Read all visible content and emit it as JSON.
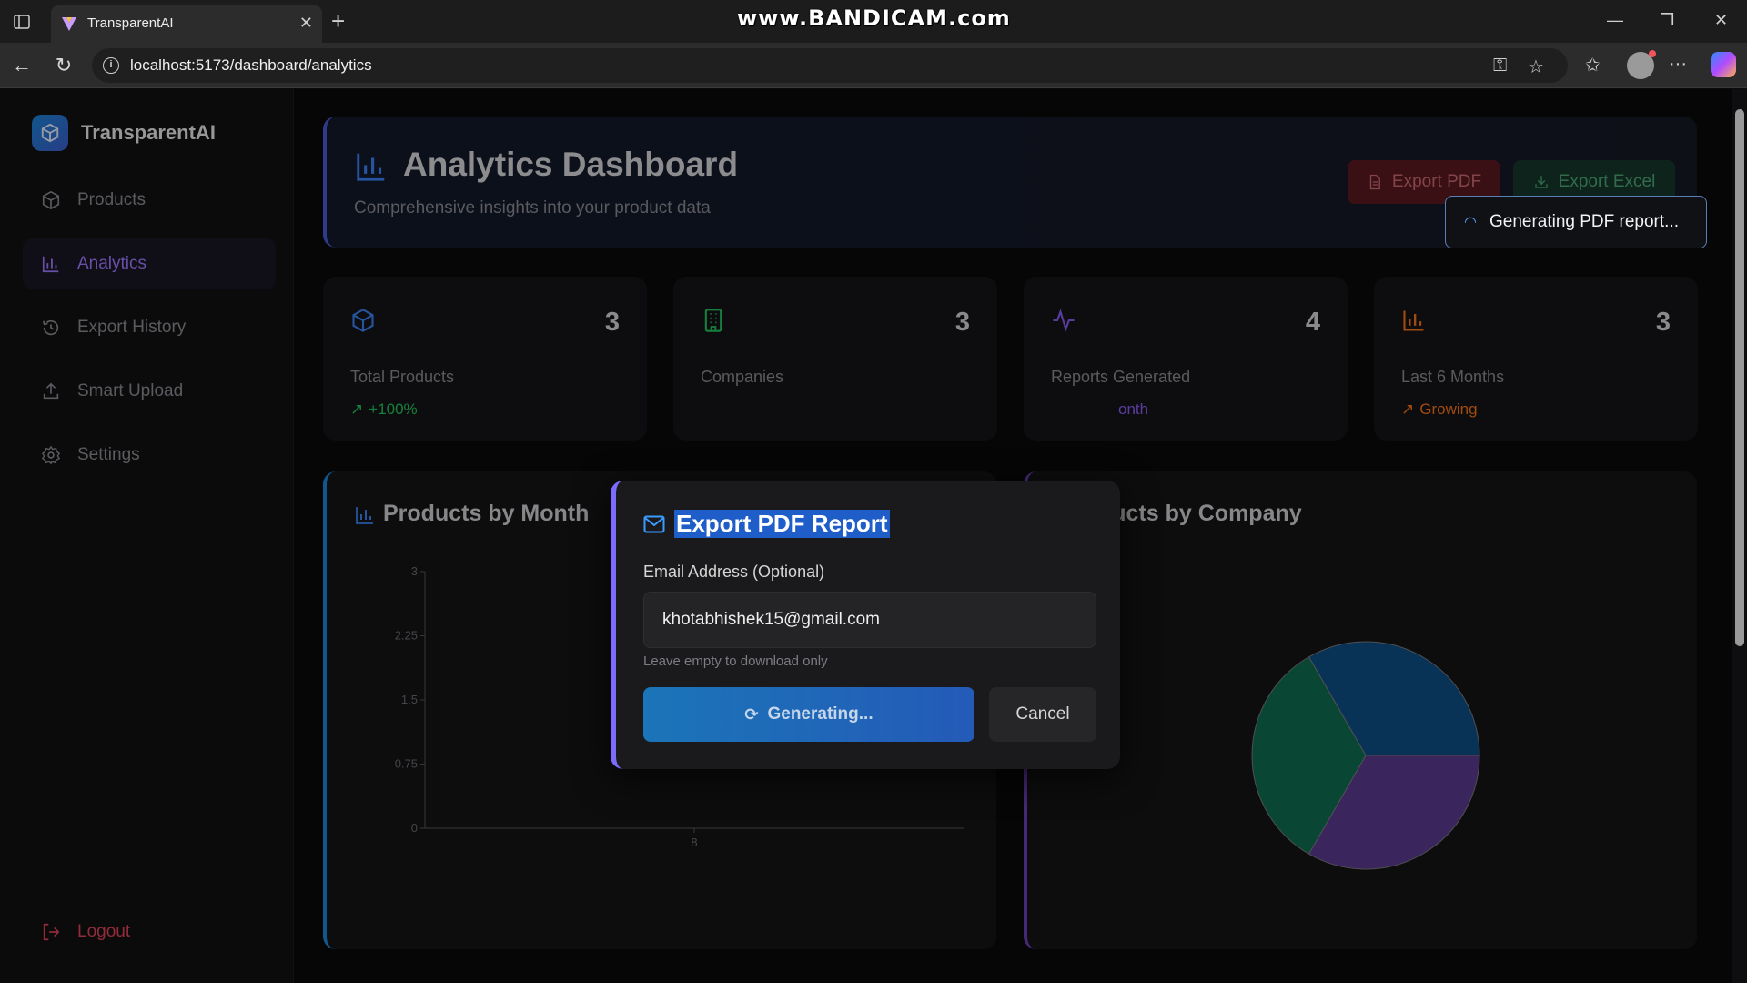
{
  "browser": {
    "tab_title": "TransparentAI",
    "url": "localhost:5173/dashboard/analytics",
    "watermark": "www.BANDICAM.com"
  },
  "sidebar": {
    "brand": "TransparentAI",
    "items": [
      {
        "label": "Products",
        "icon": "box-icon"
      },
      {
        "label": "Analytics",
        "icon": "bar-chart-icon",
        "active": true
      },
      {
        "label": "Export History",
        "icon": "history-icon"
      },
      {
        "label": "Smart Upload",
        "icon": "upload-icon"
      },
      {
        "label": "Settings",
        "icon": "gear-icon"
      }
    ],
    "logout_label": "Logout"
  },
  "header": {
    "title": "Analytics Dashboard",
    "subtitle": "Comprehensive insights into your product data",
    "export_pdf_label": "Export PDF",
    "export_excel_label": "Export Excel"
  },
  "stats": [
    {
      "value": "3",
      "label": "Total Products",
      "trend": "+100%",
      "trend_color": "#22c55e",
      "icon_color": "#3b82f6"
    },
    {
      "value": "3",
      "label": "Companies",
      "trend": "",
      "trend_color": "#22c55e",
      "icon_color": "#22c55e"
    },
    {
      "value": "4",
      "label": "Reports Generated",
      "trend": "onth",
      "trend_color": "#8b5cf6",
      "icon_color": "#8b5cf6"
    },
    {
      "value": "3",
      "label": "Last 6 Months",
      "trend": "Growing",
      "trend_color": "#f97316",
      "icon_color": "#f97316"
    }
  ],
  "charts": {
    "left_title": "Products by Month",
    "right_title": "ducts by Company"
  },
  "chart_data": [
    {
      "type": "bar",
      "title": "Products by Month",
      "categories": [
        "8"
      ],
      "values": [],
      "ylim": [
        0,
        3
      ],
      "y_ticks": [
        "0",
        "0.75",
        "1.5",
        "2.25",
        "3"
      ]
    },
    {
      "type": "pie",
      "title": "ducts by Company",
      "values": [
        1,
        1,
        1
      ],
      "colors": [
        "#0e4f84",
        "#5a3a8e",
        "#0f6e50"
      ]
    }
  ],
  "modal": {
    "title": "Export PDF Report",
    "email_label": "Email Address (Optional)",
    "email_value": "khotabhishek15@gmail.com",
    "hint": "Leave empty to download only",
    "generate_label": "Generating...",
    "cancel_label": "Cancel"
  },
  "toast": {
    "text": "Generating PDF report..."
  }
}
